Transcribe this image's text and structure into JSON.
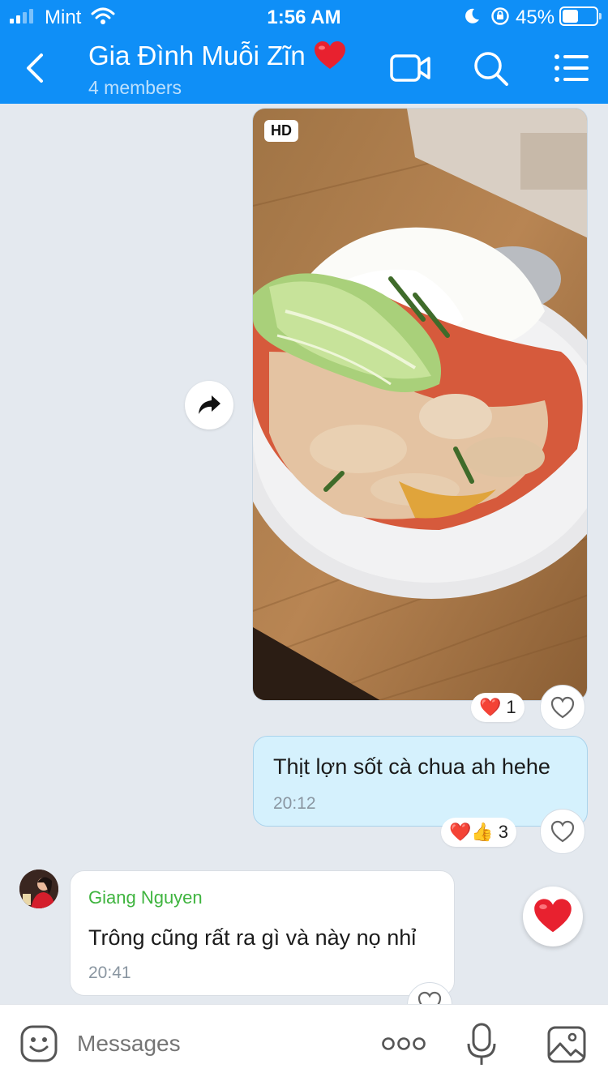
{
  "status_bar": {
    "carrier": "Mint",
    "time": "1:56 AM",
    "battery_percent": "45%",
    "battery_level": 0.45,
    "icons": [
      "signal-icon",
      "wifi-icon",
      "moon-icon",
      "orientation-lock-icon",
      "battery-icon"
    ]
  },
  "header": {
    "back_icon": "chevron-left-icon",
    "title": "Gia Đình Muỗi Zĩn",
    "title_emoji": "❤️",
    "subtitle": "4 members",
    "actions": [
      "video-call-icon",
      "search-icon",
      "menu-icon"
    ]
  },
  "messages": [
    {
      "type": "photo",
      "direction": "outgoing",
      "badge": "HD",
      "forward_icon": "forward-icon",
      "reactions": {
        "emojis": "❤️",
        "count": "1"
      }
    },
    {
      "type": "text",
      "direction": "outgoing",
      "text": "Thịt lợn sốt cà chua ah hehe",
      "time": "20:12",
      "reactions": {
        "emojis": "❤️👍",
        "count": "3"
      }
    },
    {
      "type": "text",
      "direction": "incoming",
      "sender": "Giang Nguyen",
      "text": "Trông cũng rất ra gì và này nọ nhỉ",
      "time": "20:41",
      "quick_reaction": "❤️"
    }
  ],
  "colors": {
    "header_bg": "#0f8ff7",
    "chat_bg": "#e4e9ef",
    "outgoing_bubble": "#d5f1fd",
    "incoming_bubble": "#ffffff",
    "sender_name": "#3fb43f",
    "heart": "#e8212f"
  },
  "input_bar": {
    "placeholder": "Messages",
    "icons": [
      "emoji-icon",
      "more-icon",
      "microphone-icon",
      "image-icon"
    ]
  }
}
